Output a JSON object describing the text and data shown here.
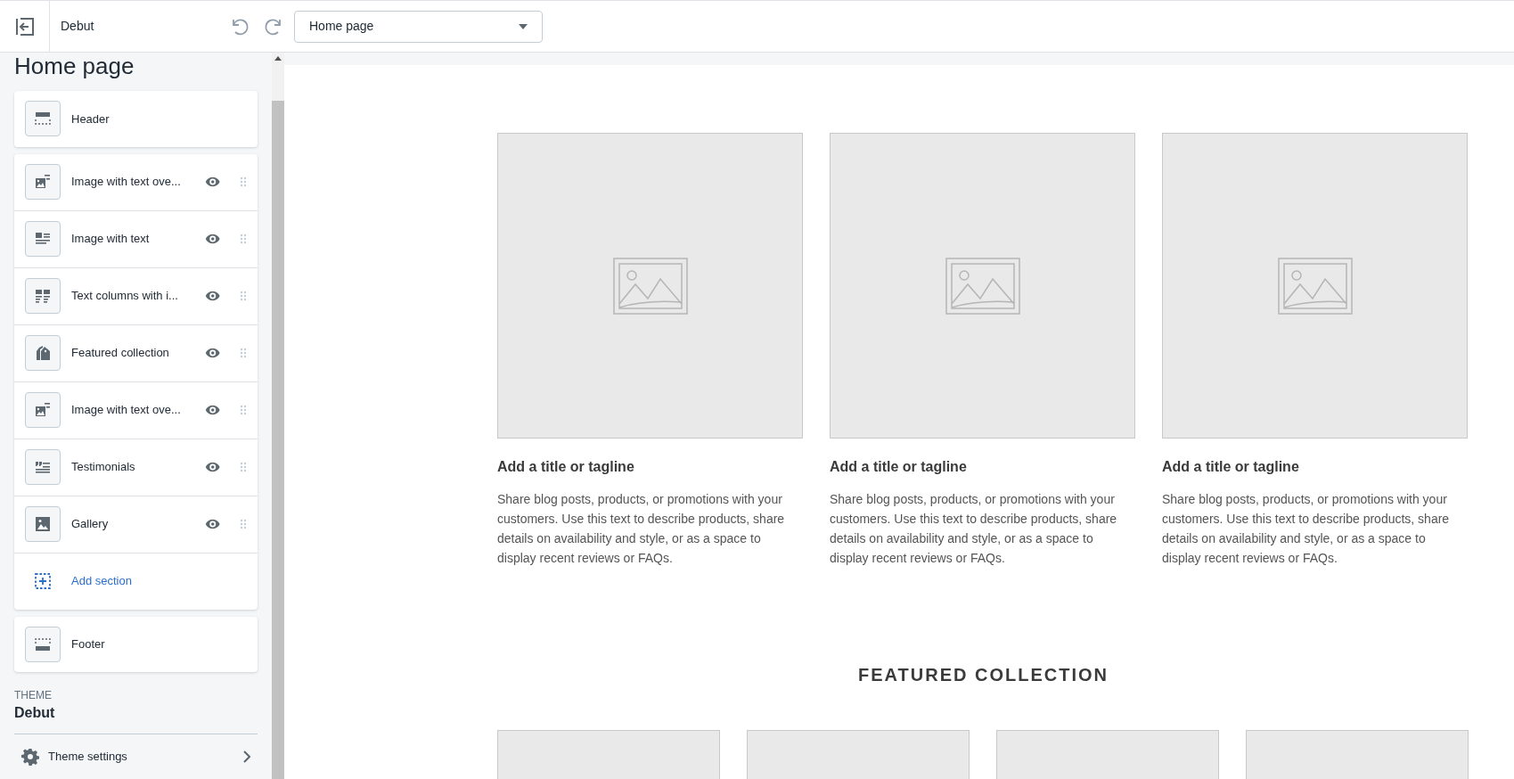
{
  "topbar": {
    "theme_name": "Debut",
    "page_select": {
      "value": "Home page"
    }
  },
  "sidebar": {
    "title": "Home page",
    "header": {
      "label": "Header",
      "kind": "header"
    },
    "sections": [
      {
        "label": "Image with text ove...",
        "kind": "image-overlay",
        "visible": true
      },
      {
        "label": "Image with text",
        "kind": "image-text",
        "visible": true
      },
      {
        "label": "Text columns with i...",
        "kind": "text-columns",
        "visible": true
      },
      {
        "label": "Featured collection",
        "kind": "collection",
        "visible": true
      },
      {
        "label": "Image with text ove...",
        "kind": "image-overlay",
        "visible": true
      },
      {
        "label": "Testimonials",
        "kind": "testimonials",
        "visible": true
      },
      {
        "label": "Gallery",
        "kind": "gallery",
        "visible": true
      }
    ],
    "add_section": "Add section",
    "footer": {
      "label": "Footer",
      "kind": "footer"
    },
    "theme": {
      "caption": "THEME",
      "name": "Debut"
    },
    "theme_settings": "Theme settings"
  },
  "preview": {
    "columns": [
      {
        "title": "Add a title or tagline",
        "text": "Share blog posts, products, or promotions with your customers. Use this text to describe products, share details on availability and style, or as a space to display recent reviews or FAQs."
      },
      {
        "title": "Add a title or tagline",
        "text": "Share blog posts, products, or promotions with your customers. Use this text to describe products, share details on availability and style, or as a space to display recent reviews or FAQs."
      },
      {
        "title": "Add a title or tagline",
        "text": "Share blog posts, products, or promotions with your customers. Use this text to describe products, share details on availability and style, or as a space to display recent reviews or FAQs."
      }
    ],
    "featured_heading": "FEATURED COLLECTION",
    "products": [
      {
        "kind": "placeholder"
      },
      {
        "kind": "placeholder"
      },
      {
        "kind": "placeholder"
      },
      {
        "kind": "placeholder"
      }
    ]
  }
}
